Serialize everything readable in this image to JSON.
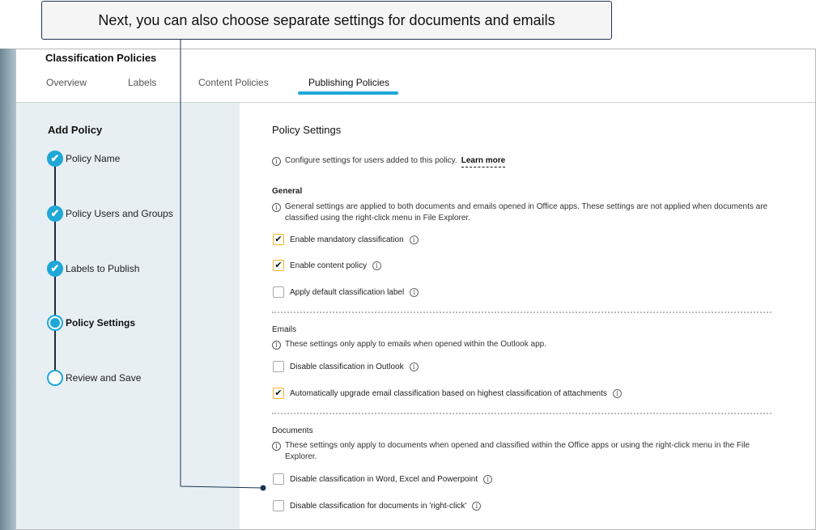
{
  "callout": {
    "text": "Next, you can also choose separate settings for documents and emails"
  },
  "header": {
    "title": "Classification Policies",
    "tabs": [
      {
        "label": "Overview"
      },
      {
        "label": "Labels"
      },
      {
        "label": "Content Policies"
      },
      {
        "label": "Publishing Policies",
        "active": true
      }
    ]
  },
  "sidebar": {
    "title": "Add Policy",
    "steps": [
      {
        "label": "Policy Name",
        "state": "done"
      },
      {
        "label": "Policy Users and Groups",
        "state": "done"
      },
      {
        "label": "Labels to Publish",
        "state": "done"
      },
      {
        "label": "Policy Settings",
        "state": "current"
      },
      {
        "label": "Review and Save",
        "state": "pending"
      }
    ]
  },
  "main": {
    "title": "Policy Settings",
    "intro": {
      "text": "Configure settings for users added to this policy.",
      "link": "Learn more"
    },
    "general": {
      "title": "General",
      "info": "General settings are applied to both documents and emails opened in Office apps. These settings are not applied when documents are classified using the right-click menu in File Explorer.",
      "options": [
        {
          "label": "Enable mandatory classification",
          "checked": true
        },
        {
          "label": "Enable content policy",
          "checked": true
        },
        {
          "label": "Apply default classification label",
          "checked": false
        }
      ]
    },
    "emails": {
      "title": "Emails",
      "info": "These settings only apply to emails when opened within the Outlook app.",
      "options": [
        {
          "label": "Disable classification in Outlook",
          "checked": false
        },
        {
          "label": "Automatically upgrade email classification based on highest classification of attachments",
          "checked": true
        }
      ]
    },
    "documents": {
      "title": "Documents",
      "info": "These settings only apply to documents when opened and classified within the Office apps or using the right-click menu in the File Explorer.",
      "options": [
        {
          "label": "Disable classification in Word, Excel and Powerpoint",
          "checked": false
        },
        {
          "label": "Disable classification for documents in 'right-click'",
          "checked": false
        }
      ]
    }
  },
  "icons": {
    "check": "✔",
    "info": "i"
  },
  "colors": {
    "accent": "#1fa7d8",
    "checkbox_border_checked": "#f0b429",
    "callout_border": "#1e3355"
  }
}
